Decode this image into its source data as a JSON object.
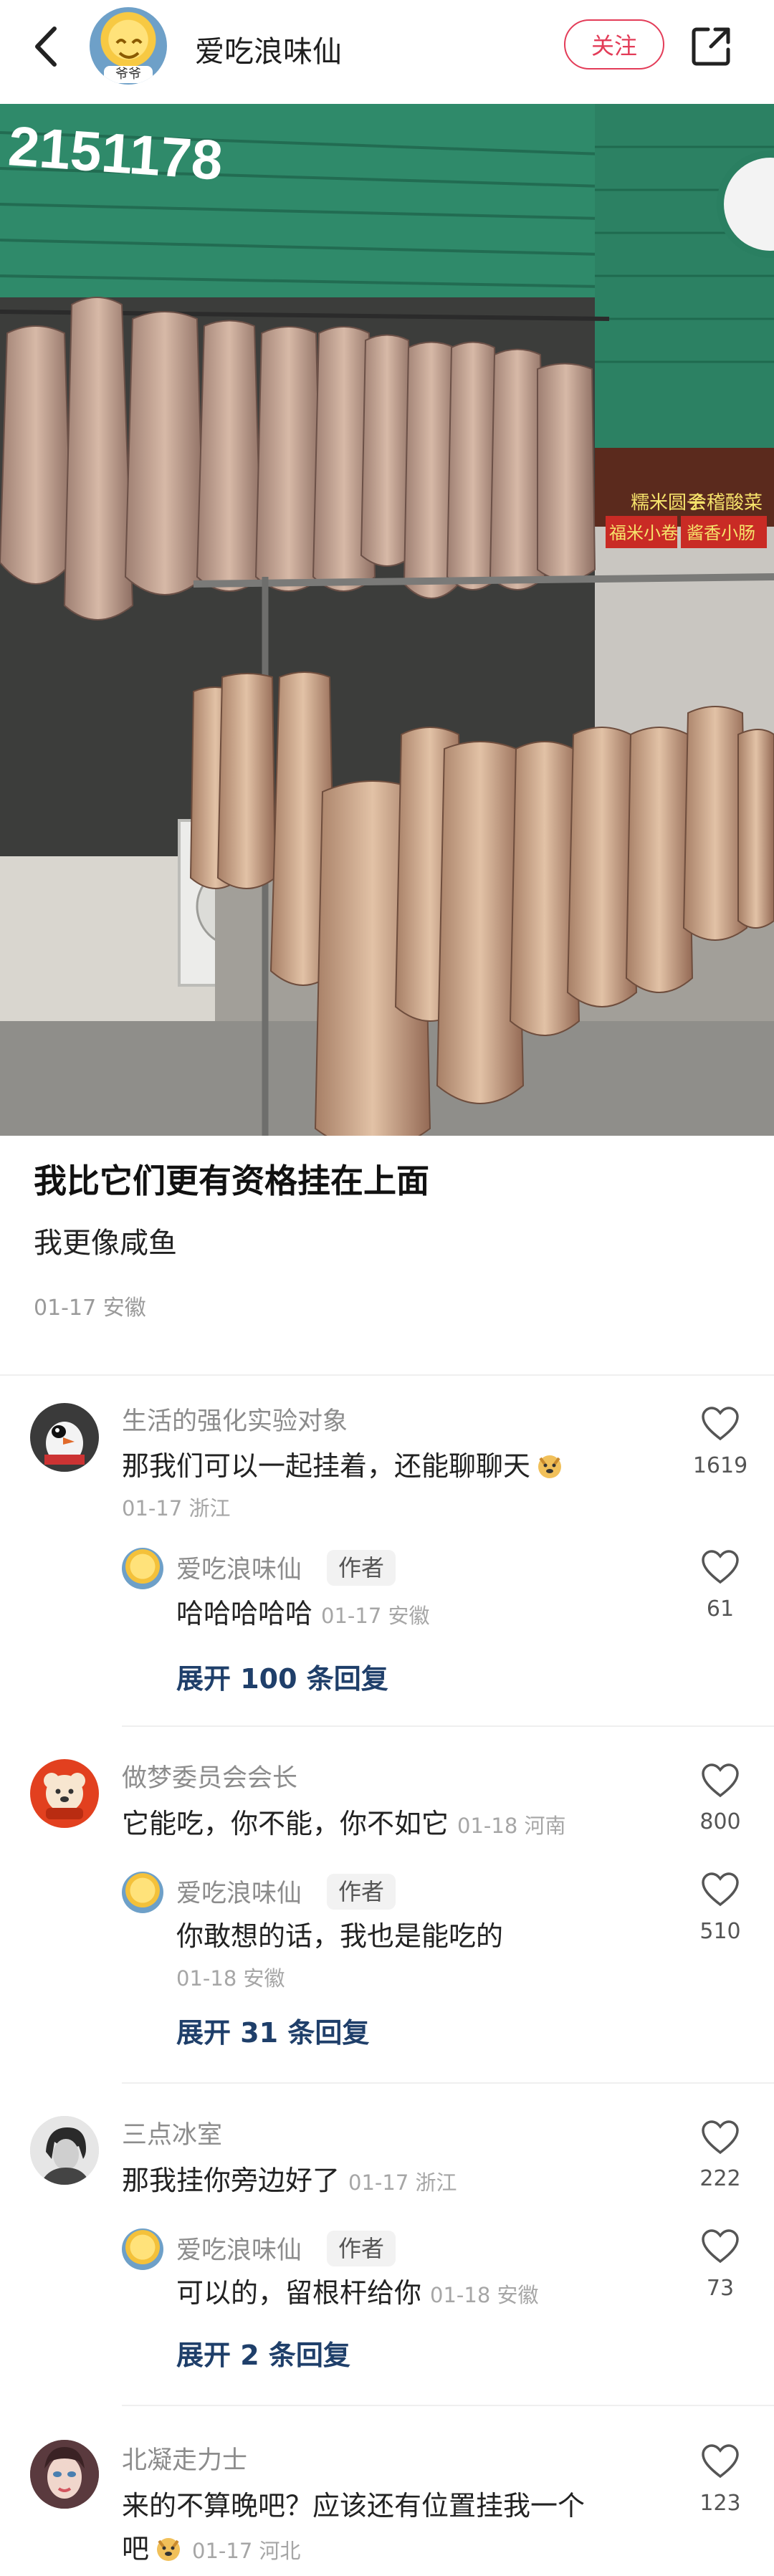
{
  "header": {
    "author_name": "爱吃浪味仙",
    "avatar_tag": "爷爷",
    "follow_label": "关注"
  },
  "photo": {
    "sign_number": "2151178",
    "shop_sign_1": "糯米圆子",
    "shop_sign_2": "会稽酸菜",
    "shop_sign_3": "福米小卷",
    "shop_sign_4": "酱香小肠"
  },
  "post": {
    "title": "我比它们更有资格挂在上面",
    "body": "我更像咸鱼",
    "meta": "01-17 安徽"
  },
  "comments": [
    {
      "nickname": "生活的强化实验对象",
      "text": "那我们可以一起挂着，还能聊聊天",
      "meta": "01-17 浙江",
      "likes": "1619",
      "reply": {
        "nickname": "爱吃浪味仙",
        "tag": "作者",
        "text": "哈哈哈哈哈",
        "meta": "01-17 安徽",
        "likes": "61"
      },
      "expand_label": "展开 100 条回复"
    },
    {
      "nickname": "做梦委员会会长",
      "text": "它能吃，你不能，你不如它",
      "meta": "01-18 河南",
      "likes": "800",
      "reply": {
        "nickname": "爱吃浪味仙",
        "tag": "作者",
        "text": "你敢想的话，我也是能吃的",
        "meta": "01-18 安徽",
        "likes": "510"
      },
      "expand_label": "展开 31 条回复"
    },
    {
      "nickname": "三点冰室",
      "text": "那我挂你旁边好了",
      "meta": "01-17 浙江",
      "likes": "222",
      "reply": {
        "nickname": "爱吃浪味仙",
        "tag": "作者",
        "text": "可以的，留根杆给你",
        "meta": "01-18 安徽",
        "likes": "73"
      },
      "expand_label": "展开 2 条回复"
    },
    {
      "nickname": "北凝走力士",
      "text_line1": "来的不算晚吧？应该还有位置挂我一个",
      "text_line2": "吧",
      "meta": "01-17 河北",
      "likes": "123"
    }
  ]
}
